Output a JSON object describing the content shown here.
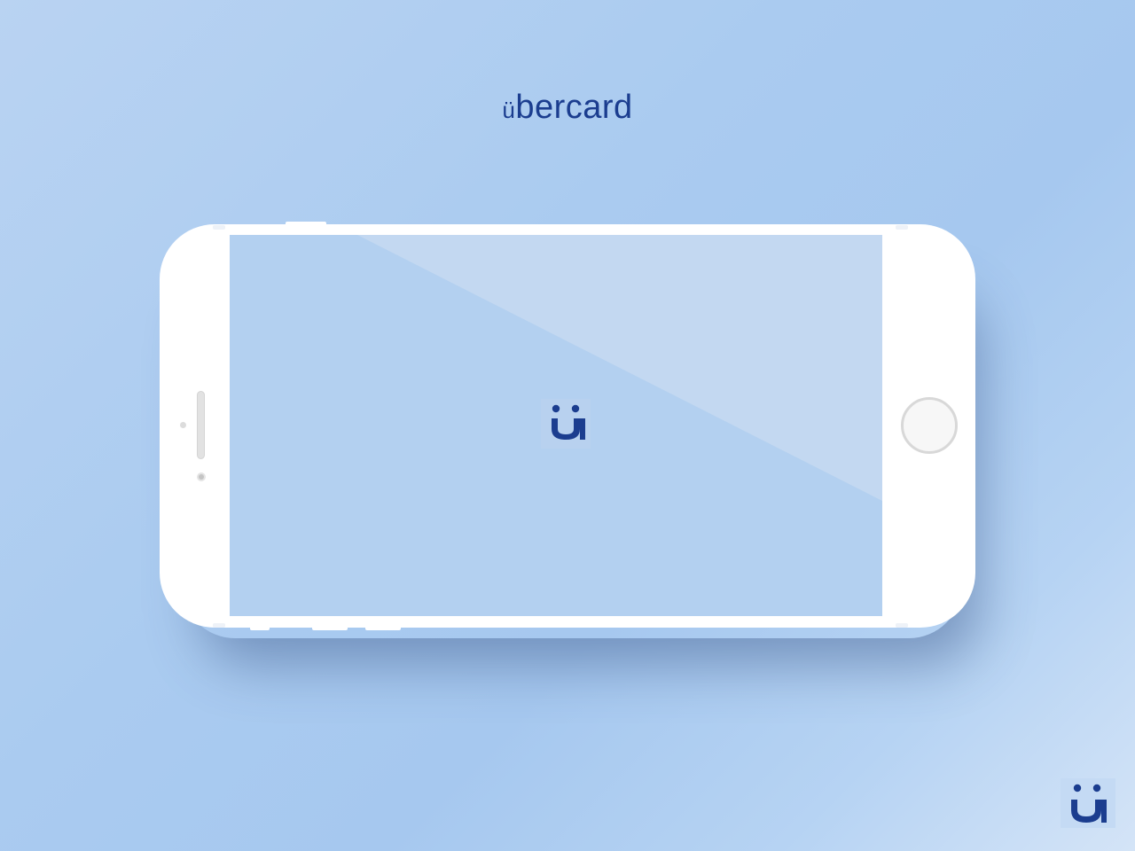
{
  "brand": {
    "wordmark_prefix": "ü",
    "wordmark_rest": "bercard",
    "logo_glyph": "ü"
  },
  "colors": {
    "brand_navy": "#1b3d8f",
    "background": "#aacbf0",
    "screen": "#b3d0f0",
    "device_body": "#ffffff"
  },
  "device": {
    "type": "smartphone",
    "orientation": "landscape",
    "screen_content": "ubercard-logo-icon"
  }
}
